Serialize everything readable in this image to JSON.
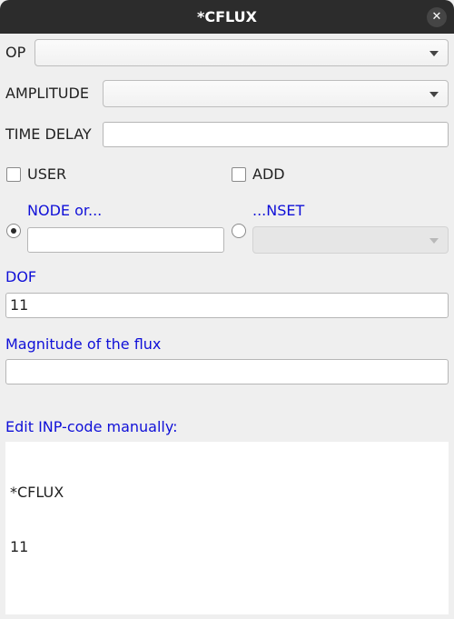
{
  "window": {
    "title": "*CFLUX"
  },
  "op": {
    "label": "OP",
    "value": ""
  },
  "amplitude": {
    "label": "AMPLITUDE",
    "value": ""
  },
  "time_delay": {
    "label": "TIME DELAY",
    "value": ""
  },
  "user": {
    "label": "USER",
    "checked": false
  },
  "add": {
    "label": "ADD",
    "checked": false
  },
  "node": {
    "label": "NODE or...",
    "selected": true,
    "value": ""
  },
  "nset": {
    "label": "...NSET",
    "selected": false,
    "value": ""
  },
  "dof": {
    "label": "DOF",
    "value": "11"
  },
  "magnitude": {
    "label": "Magnitude of the flux",
    "value": ""
  },
  "editor": {
    "label": "Edit INP-code manually:",
    "lines": [
      "*CFLUX",
      "11"
    ]
  },
  "colors": {
    "title_bar": "#2c2c2c",
    "label_blue": "#1010d8",
    "background": "#efefef"
  }
}
